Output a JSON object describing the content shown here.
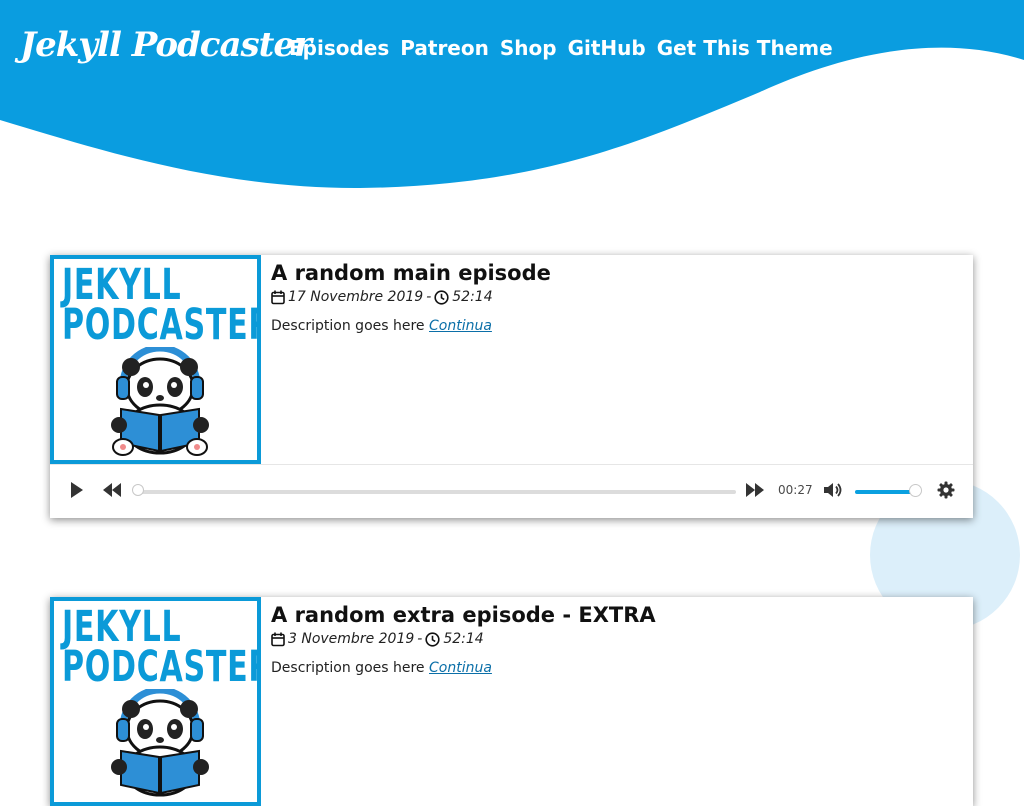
{
  "header": {
    "brand": "Jekyll Podcaster",
    "nav": [
      "Episodes",
      "Patreon",
      "Shop",
      "GitHub",
      "Get This Theme"
    ]
  },
  "colors": {
    "accent": "#0a9de0",
    "cover_blue": "#0b9ad8",
    "link": "#0b6fa8",
    "deco_circle": "#dceffa"
  },
  "episodes": [
    {
      "cover_text": [
        "JEKYLL",
        "PODCASTER"
      ],
      "title": "A random main episode",
      "date": "17 Novembre 2019",
      "separator": "-",
      "duration": "52:14",
      "description": "Description goes here",
      "continue_label": "Continua",
      "player": {
        "current_time": "00:27",
        "progress_fraction": 0.0,
        "volume_fraction": 1.0
      },
      "icons": [
        "calendar-icon",
        "clock-icon",
        "play-icon",
        "rewind-icon",
        "fast-forward-icon",
        "volume-icon",
        "settings-gear-icon"
      ]
    },
    {
      "cover_text": [
        "JEKYLL",
        "PODCASTER"
      ],
      "title": "A random extra episode - EXTRA",
      "date": "3 Novembre 2019",
      "separator": "-",
      "duration": "52:14",
      "description": "Description goes here",
      "continue_label": "Continua",
      "icons": [
        "calendar-icon",
        "clock-icon"
      ]
    }
  ]
}
